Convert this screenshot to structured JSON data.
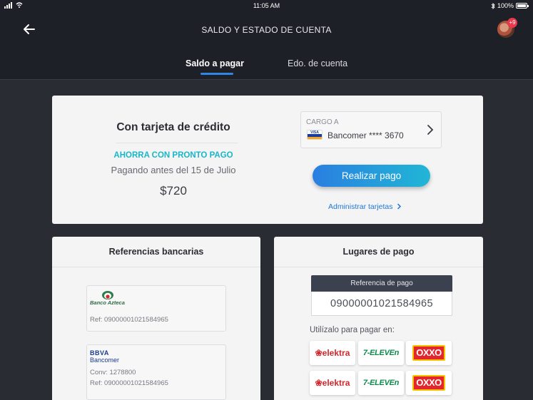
{
  "status_bar": {
    "time": "11:05 AM",
    "battery": "100%",
    "battery_level": 1.0
  },
  "header": {
    "title": "SALDO Y ESTADO DE CUENTA",
    "notification_count": "+9",
    "back_icon": "arrow-left-icon"
  },
  "tabs": [
    {
      "label": "Saldo a pagar",
      "active": true
    },
    {
      "label": "Edo. de cuenta",
      "active": false
    }
  ],
  "main_card": {
    "title": "Con tarjeta de crédito",
    "promo": "AHORRA CON PRONTO PAGO",
    "promo_sub": "Pagando antes del 15 de Julio",
    "amount": "$720",
    "cargo_label": "CARGO A",
    "card_brand_icon": "visa-card-icon",
    "card_brand_text": "VISA",
    "card_name": "Bancomer **** 3670",
    "pay_button": "Realizar pago",
    "admin_link": "Administrar tarjetas"
  },
  "bank_refs": {
    "title": "Referencias bancarias",
    "azteca": {
      "name": "Banco Azteca",
      "ref": "Ref: 09000001021584965"
    },
    "bbva": {
      "logo": "BBVA",
      "sub": "Bancomer",
      "conv": "Conv: 1278800",
      "ref": "Ref: 09000001021584965"
    }
  },
  "places": {
    "title": "Lugares de pago",
    "ref_label": "Referencia de pago",
    "ref_value": "09000001021584965",
    "use_label": "Utilízalo para pagar en:",
    "stores": [
      {
        "elektra": "elektra",
        "seven": "7-ELEVEn",
        "oxxo": "OXXO"
      },
      {
        "elektra": "elektra",
        "seven": "7-ELEVEn",
        "oxxo": "OXXO"
      }
    ]
  },
  "colors": {
    "accent": "#2f86e6",
    "promo": "#17b7c9",
    "link": "#1f78d6",
    "dark": "#1e2027"
  }
}
